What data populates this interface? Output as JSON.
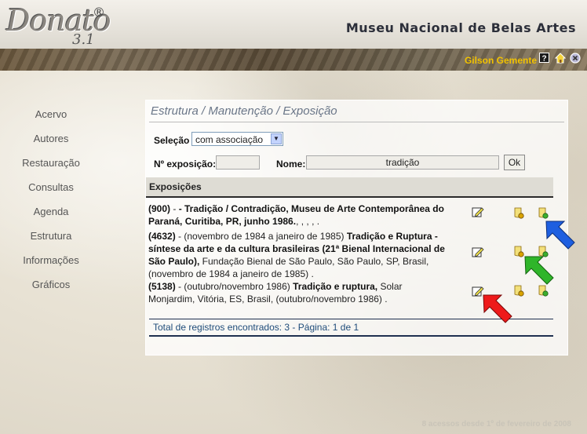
{
  "app": {
    "logo_text": "Donato",
    "logo_registered": "®",
    "logo_version": "3.1",
    "museum_name": "Museu Nacional de Belas Artes"
  },
  "topbar": {
    "user_name": "Gilson Gemente",
    "icons": [
      "help-icon",
      "home-icon",
      "exit-icon"
    ]
  },
  "sidebar": {
    "items": [
      {
        "label": "Acervo"
      },
      {
        "label": "Autores"
      },
      {
        "label": "Restauração"
      },
      {
        "label": "Consultas"
      },
      {
        "label": "Agenda"
      },
      {
        "label": "Estrutura"
      },
      {
        "label": "Informações"
      },
      {
        "label": "Gráficos"
      }
    ]
  },
  "panel": {
    "title": "Estrutura / Manutenção / Exposição",
    "selection_label": "Seleção",
    "selection_value": "com associação",
    "exhibition_no_label": "Nº exposição:",
    "exhibition_no_value": "",
    "name_label": "Nome:",
    "name_value": "tradição",
    "ok_label": "Ok",
    "section_title": "Exposições",
    "records": [
      {
        "id": "(900)",
        "sep": " - ",
        "title": "- Tradição / Contradição, Museu de Arte Contemporânea do Paraná, Curitiba, PR, junho 1986.",
        "rest": ", , , , ."
      },
      {
        "id": "(4632)",
        "sep": " - (novembro de 1984 a janeiro de 1985) ",
        "title": "Tradição e Ruptura - síntese da arte e da cultura brasileiras (21ª Bienal Internacional de São Paulo),",
        "rest": " Fundação Bienal de São Paulo, São Paulo, SP, Brasil, (novembro de 1984 a janeiro de 1985) ."
      },
      {
        "id": "(5138)",
        "sep": " - (outubro/novembro 1986) ",
        "title": "Tradição e ruptura,",
        "rest": " Solar Monjardim, Vitória, ES, Brasil, (outubro/novembro 1986) ."
      }
    ],
    "footer": "Total de registros encontrados: 3 - Página: 1 de 1"
  },
  "visits": "8 acessos desde 1º de fevereiro de 2008",
  "colors": {
    "arrow_blue": "#1e5fe0",
    "arrow_green": "#2fb52a",
    "arrow_red": "#ee1a1a",
    "user_name": "#f2c200",
    "title": "#6a7688"
  }
}
